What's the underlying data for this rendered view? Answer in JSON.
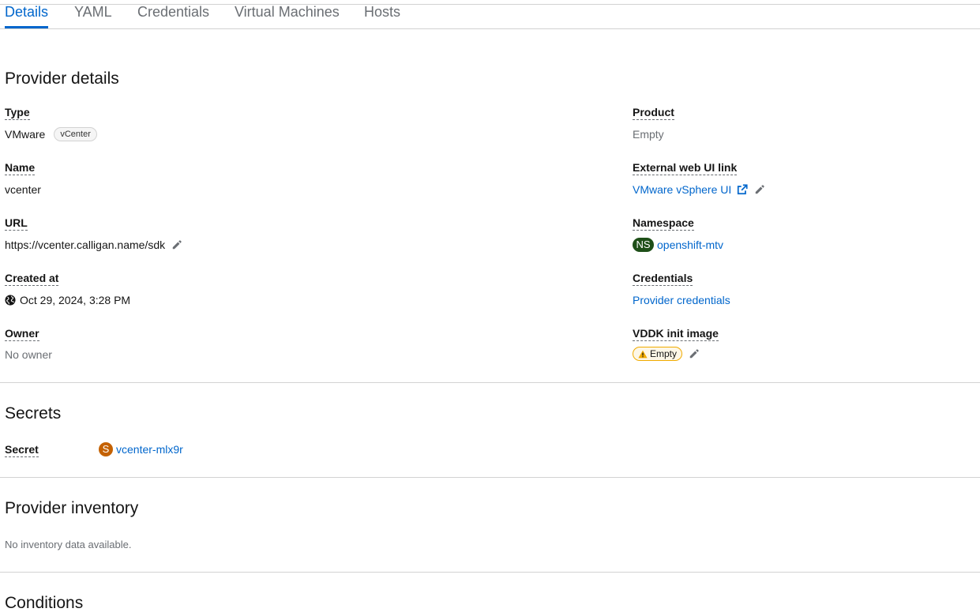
{
  "tabs": [
    "Details",
    "YAML",
    "Credentials",
    "Virtual Machines",
    "Hosts"
  ],
  "provider_details": {
    "title": "Provider details",
    "type_label": "Type",
    "type_value": "VMware",
    "type_chip": "vCenter",
    "name_label": "Name",
    "name_value": "vcenter",
    "url_label": "URL",
    "url_value": "https://vcenter.calligan.name/sdk",
    "created_label": "Created at",
    "created_value": "Oct 29, 2024, 3:28 PM",
    "owner_label": "Owner",
    "owner_value": "No owner",
    "product_label": "Product",
    "product_value": "Empty",
    "weblink_label": "External web UI link",
    "weblink_value": "VMware vSphere UI",
    "namespace_label": "Namespace",
    "namespace_badge": "NS",
    "namespace_value": "openshift-mtv",
    "credentials_label": "Credentials",
    "credentials_value": "Provider credentials",
    "vddk_label": "VDDK init image",
    "vddk_value": "Empty"
  },
  "secrets": {
    "title": "Secrets",
    "secret_label": "Secret",
    "secret_badge": "S",
    "secret_value": "vcenter-mlx9r"
  },
  "inventory": {
    "title": "Provider inventory",
    "empty_text": "No inventory data available."
  },
  "conditions": {
    "title": "Conditions"
  },
  "colors": {
    "link": "#0066cc",
    "namespace_badge": "#1e4f18",
    "secret_badge": "#c46100",
    "warning": "#f0ab00"
  }
}
